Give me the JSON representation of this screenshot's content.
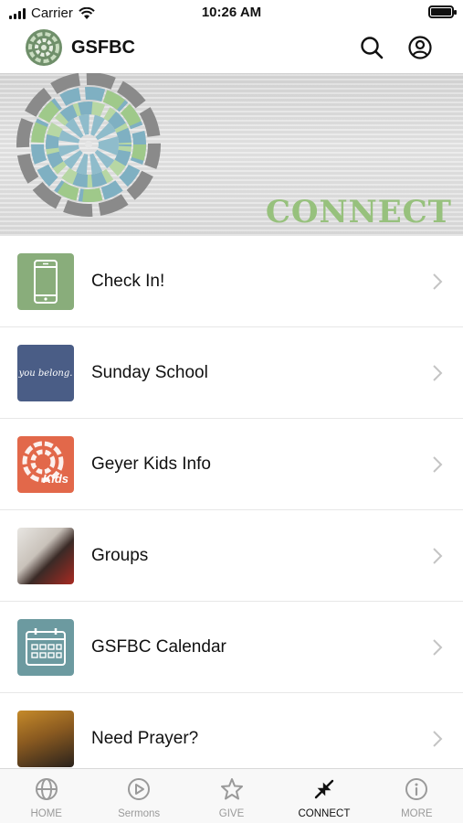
{
  "status_bar": {
    "carrier": "Carrier",
    "time": "10:26 AM"
  },
  "header": {
    "title": "GSFBC",
    "icons": [
      "search-icon",
      "account-icon"
    ]
  },
  "banner": {
    "title": "CONNECT",
    "accent_color": "#97c17d"
  },
  "menu": {
    "items": [
      {
        "label": "Check In!",
        "thumb": "phone-icon"
      },
      {
        "label": "Sunday School",
        "thumb_text": "you belong."
      },
      {
        "label": "Geyer Kids Info",
        "thumb_text": "Kids"
      },
      {
        "label": "Groups",
        "thumb": "groups-photo"
      },
      {
        "label": "GSFBC Calendar",
        "thumb": "calendar-icon"
      },
      {
        "label": "Need Prayer?",
        "thumb": "prayer-photo"
      }
    ]
  },
  "tab_bar": {
    "tabs": [
      {
        "label": "HOME",
        "icon": "globe-icon"
      },
      {
        "label": "Sermons",
        "icon": "play-circle-icon"
      },
      {
        "label": "GIVE",
        "icon": "star-icon"
      },
      {
        "label": "CONNECT",
        "icon": "connect-arrows-icon"
      },
      {
        "label": "MORE",
        "icon": "info-icon"
      }
    ],
    "active": "CONNECT"
  }
}
